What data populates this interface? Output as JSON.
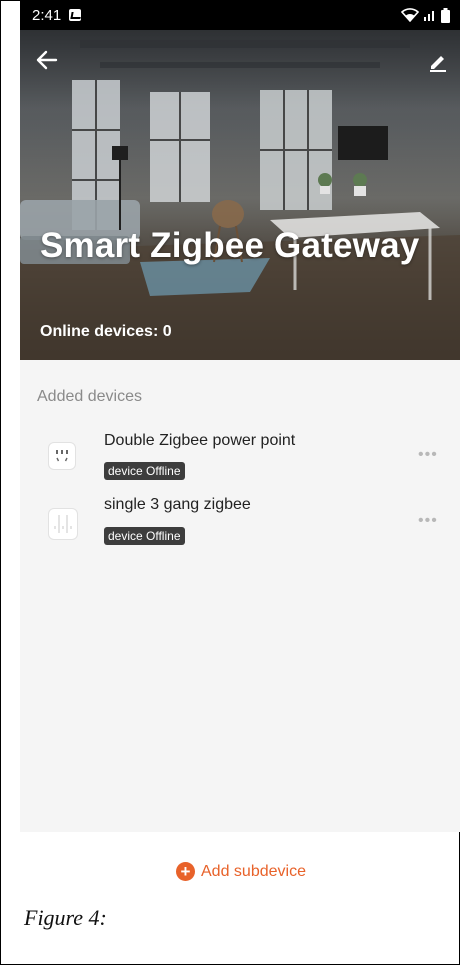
{
  "status_bar": {
    "time": "2:41"
  },
  "header": {
    "title": "Smart Zigbee Gateway",
    "online_devices": "Online devices: 0"
  },
  "section": {
    "title": "Added devices"
  },
  "devices": [
    {
      "name": "Double Zigbee power point",
      "status": "device Offline",
      "icon": "power-point-icon"
    },
    {
      "name": "single 3 gang zigbee",
      "status": "device Offline",
      "icon": "wall-switch-icon"
    }
  ],
  "actions": {
    "add_subdevice": "Add subdevice"
  },
  "caption": "Figure 4:",
  "colors": {
    "accent": "#e8622a",
    "badge": "#3d3d3d",
    "panel": "#f5f5f5"
  }
}
